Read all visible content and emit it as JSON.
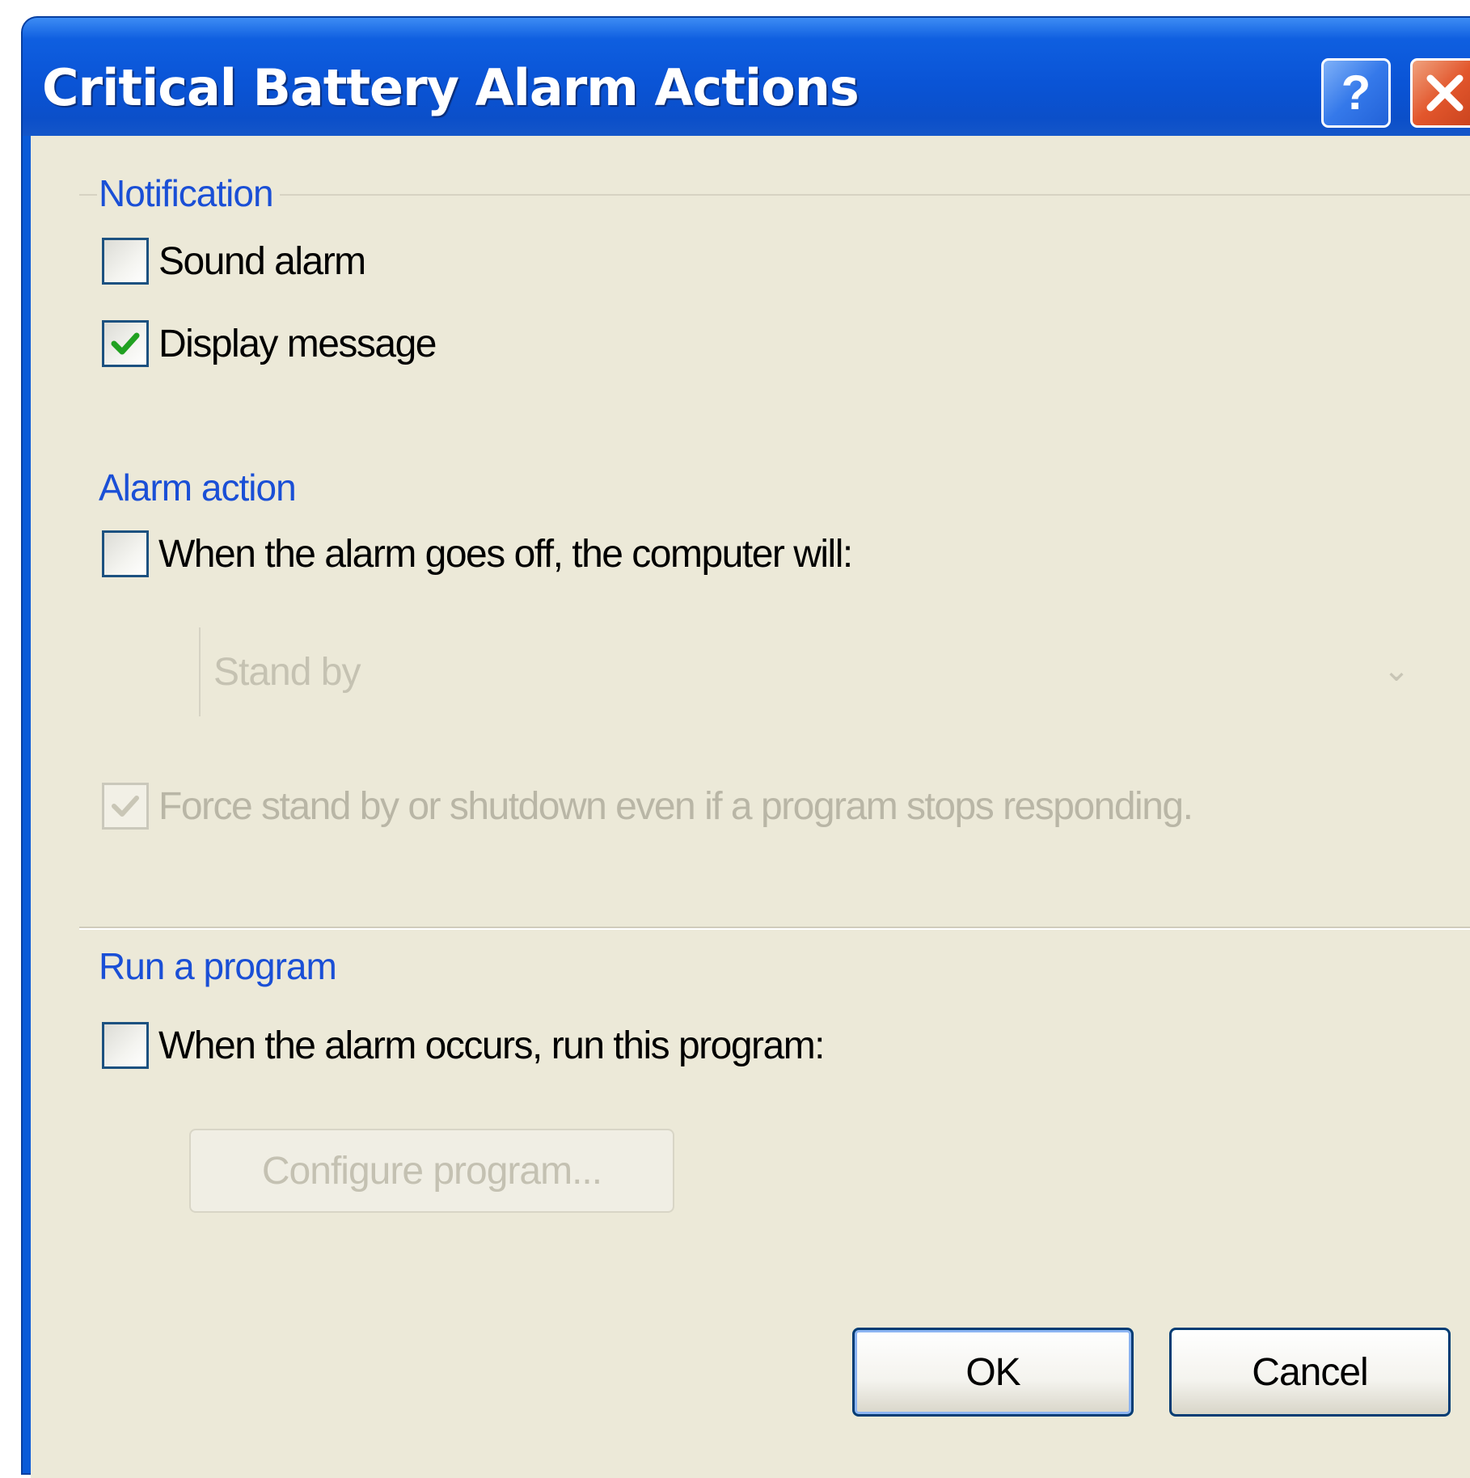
{
  "window": {
    "title": "Critical Battery Alarm Actions",
    "help_button_glyph": "?",
    "close_button_icon": "close-icon"
  },
  "notification": {
    "group_label": "Notification",
    "sound_alarm": {
      "label": "Sound alarm",
      "checked": false
    },
    "display_message": {
      "label": "Display message",
      "checked": true
    }
  },
  "alarm_action": {
    "group_label": "Alarm action",
    "enable": {
      "label": "When the alarm goes off, the computer will:",
      "checked": false
    },
    "action_select": {
      "value": "Stand by",
      "enabled": false
    },
    "force": {
      "label": "Force stand by or shutdown even if a program stops responding.",
      "checked": true,
      "enabled": false
    }
  },
  "run_program": {
    "group_label": "Run a program",
    "enable": {
      "label": "When the alarm occurs, run this program:",
      "checked": false
    },
    "configure_button": {
      "label": "Configure program...",
      "enabled": false
    }
  },
  "buttons": {
    "ok": "OK",
    "cancel": "Cancel"
  },
  "colors": {
    "titlebar": "#0a54d6",
    "client_background": "#ece9d8",
    "group_label": "#1a4fd6",
    "check_green": "#21a121"
  }
}
